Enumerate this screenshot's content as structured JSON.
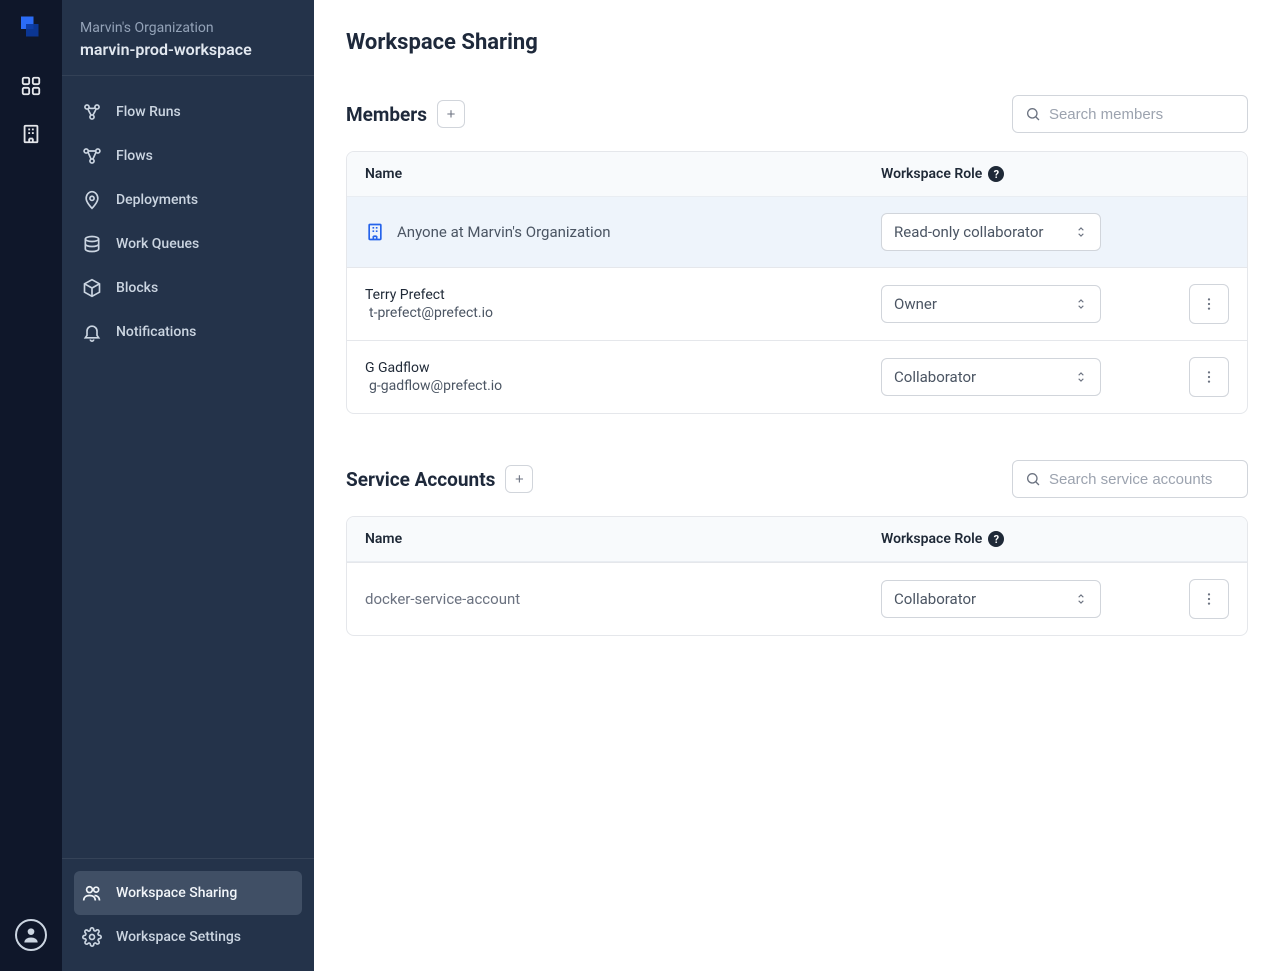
{
  "org_name": "Marvin's Organization",
  "workspace_name": "marvin-prod-workspace",
  "sidebar": {
    "nav": [
      {
        "label": "Flow Runs"
      },
      {
        "label": "Flows"
      },
      {
        "label": "Deployments"
      },
      {
        "label": "Work Queues"
      },
      {
        "label": "Blocks"
      },
      {
        "label": "Notifications"
      }
    ],
    "footer": [
      {
        "label": "Workspace Sharing",
        "active": true
      },
      {
        "label": "Workspace Settings"
      }
    ]
  },
  "page": {
    "title": "Workspace Sharing",
    "members_heading": "Members",
    "service_heading": "Service Accounts",
    "col_name": "Name",
    "col_role": "Workspace Role",
    "search_members_placeholder": "Search members",
    "search_service_placeholder": "Search service accounts"
  },
  "members": {
    "org_row": {
      "label": "Anyone at Marvin's Organization",
      "role": "Read-only collaborator"
    },
    "rows": [
      {
        "name": "Terry Prefect",
        "email": "t-prefect@prefect.io",
        "role": "Owner"
      },
      {
        "name": "G Gadflow",
        "email": "g-gadflow@prefect.io",
        "role": "Collaborator"
      }
    ]
  },
  "service_accounts": {
    "rows": [
      {
        "name": "docker-service-account",
        "role": "Collaborator"
      }
    ]
  }
}
